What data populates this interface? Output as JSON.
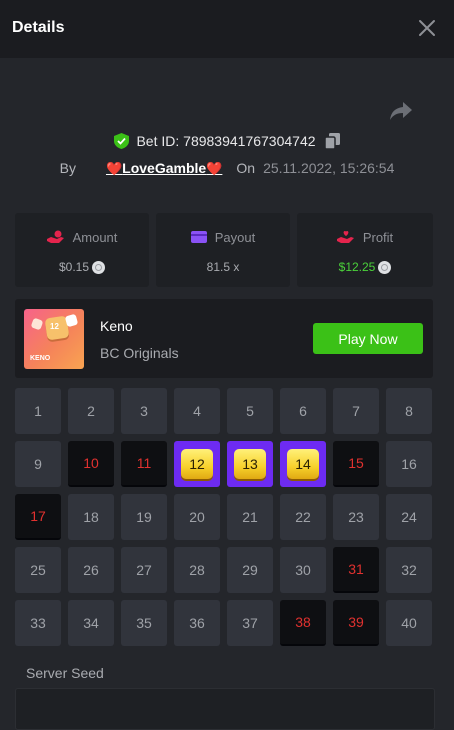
{
  "header": {
    "title": "Details"
  },
  "bet": {
    "id_label": "Bet ID: 78983941767304742",
    "by_label": "By",
    "username": "LoveGamble",
    "heart_left": "❤️",
    "heart_right": "❤️",
    "on_label": "On",
    "date": "25.11.2022, 15:26:54"
  },
  "stats": {
    "amount_label": "Amount",
    "amount_value": "$0.15",
    "payout_label": "Payout",
    "payout_value": "81.5 x",
    "profit_label": "Profit",
    "profit_value": "$12.25"
  },
  "game": {
    "name": "Keno",
    "provider": "BC Originals",
    "play_label": "Play Now",
    "thumb_text": "KENO",
    "thumb_number": "12"
  },
  "grid": {
    "numbers": [
      "1",
      "2",
      "3",
      "4",
      "5",
      "6",
      "7",
      "8",
      "9",
      "10",
      "11",
      "12",
      "13",
      "14",
      "15",
      "16",
      "17",
      "18",
      "19",
      "20",
      "21",
      "22",
      "23",
      "24",
      "25",
      "26",
      "27",
      "28",
      "29",
      "30",
      "31",
      "32",
      "33",
      "34",
      "35",
      "36",
      "37",
      "38",
      "39",
      "40"
    ],
    "hits": [
      12,
      13,
      14
    ],
    "misses": [
      10,
      11,
      15,
      17,
      31,
      38,
      39
    ]
  },
  "seed": {
    "label": "Server Seed"
  },
  "colors": {
    "accent_green": "#3bc117",
    "hit_purple": "#6d2bf2",
    "miss_red": "#e0312f",
    "profit_green": "#4bd23a"
  },
  "icons": {
    "close": "close-icon",
    "share": "share-icon",
    "verified": "shield-check-icon",
    "copy": "copy-icon",
    "amount": "hand-coin-icon",
    "payout": "wallet-icon",
    "profit": "hand-heart-icon"
  }
}
